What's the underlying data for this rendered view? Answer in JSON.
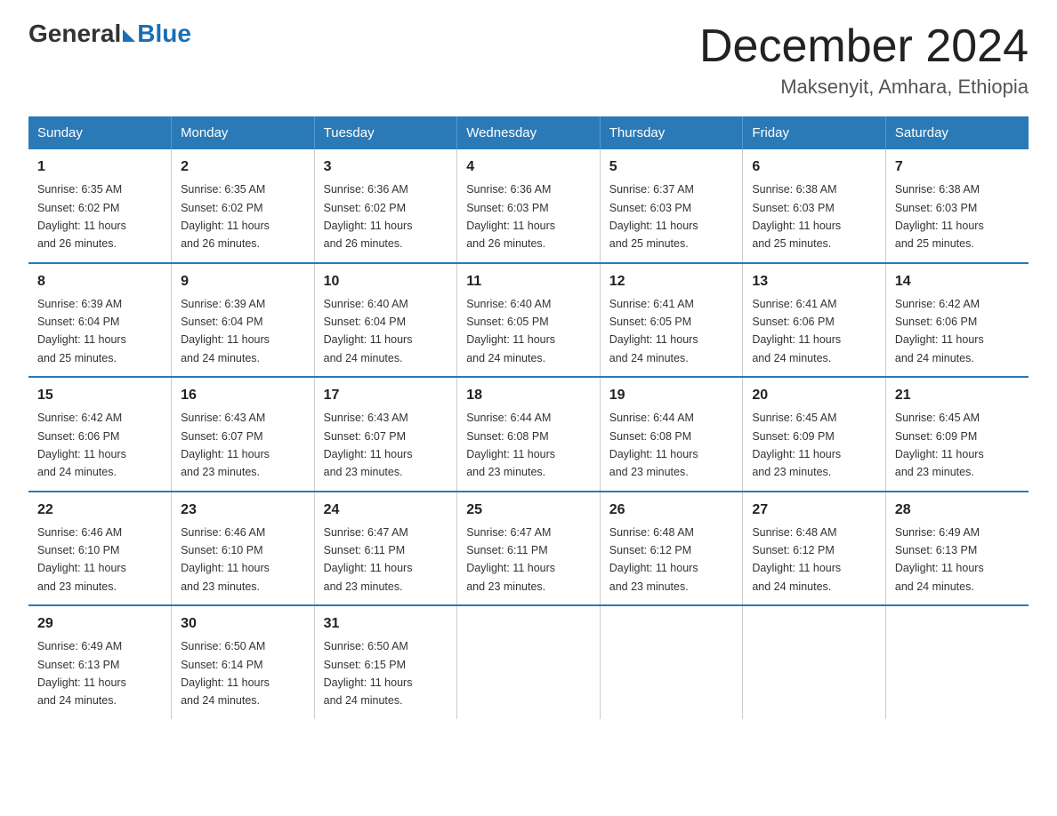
{
  "header": {
    "logo_general": "General",
    "logo_blue": "Blue",
    "title": "December 2024",
    "subtitle": "Maksenyit, Amhara, Ethiopia"
  },
  "days_of_week": [
    "Sunday",
    "Monday",
    "Tuesday",
    "Wednesday",
    "Thursday",
    "Friday",
    "Saturday"
  ],
  "weeks": [
    [
      {
        "day": "1",
        "sunrise": "6:35 AM",
        "sunset": "6:02 PM",
        "daylight": "11 hours and 26 minutes."
      },
      {
        "day": "2",
        "sunrise": "6:35 AM",
        "sunset": "6:02 PM",
        "daylight": "11 hours and 26 minutes."
      },
      {
        "day": "3",
        "sunrise": "6:36 AM",
        "sunset": "6:02 PM",
        "daylight": "11 hours and 26 minutes."
      },
      {
        "day": "4",
        "sunrise": "6:36 AM",
        "sunset": "6:03 PM",
        "daylight": "11 hours and 26 minutes."
      },
      {
        "day": "5",
        "sunrise": "6:37 AM",
        "sunset": "6:03 PM",
        "daylight": "11 hours and 25 minutes."
      },
      {
        "day": "6",
        "sunrise": "6:38 AM",
        "sunset": "6:03 PM",
        "daylight": "11 hours and 25 minutes."
      },
      {
        "day": "7",
        "sunrise": "6:38 AM",
        "sunset": "6:03 PM",
        "daylight": "11 hours and 25 minutes."
      }
    ],
    [
      {
        "day": "8",
        "sunrise": "6:39 AM",
        "sunset": "6:04 PM",
        "daylight": "11 hours and 25 minutes."
      },
      {
        "day": "9",
        "sunrise": "6:39 AM",
        "sunset": "6:04 PM",
        "daylight": "11 hours and 24 minutes."
      },
      {
        "day": "10",
        "sunrise": "6:40 AM",
        "sunset": "6:04 PM",
        "daylight": "11 hours and 24 minutes."
      },
      {
        "day": "11",
        "sunrise": "6:40 AM",
        "sunset": "6:05 PM",
        "daylight": "11 hours and 24 minutes."
      },
      {
        "day": "12",
        "sunrise": "6:41 AM",
        "sunset": "6:05 PM",
        "daylight": "11 hours and 24 minutes."
      },
      {
        "day": "13",
        "sunrise": "6:41 AM",
        "sunset": "6:06 PM",
        "daylight": "11 hours and 24 minutes."
      },
      {
        "day": "14",
        "sunrise": "6:42 AM",
        "sunset": "6:06 PM",
        "daylight": "11 hours and 24 minutes."
      }
    ],
    [
      {
        "day": "15",
        "sunrise": "6:42 AM",
        "sunset": "6:06 PM",
        "daylight": "11 hours and 24 minutes."
      },
      {
        "day": "16",
        "sunrise": "6:43 AM",
        "sunset": "6:07 PM",
        "daylight": "11 hours and 23 minutes."
      },
      {
        "day": "17",
        "sunrise": "6:43 AM",
        "sunset": "6:07 PM",
        "daylight": "11 hours and 23 minutes."
      },
      {
        "day": "18",
        "sunrise": "6:44 AM",
        "sunset": "6:08 PM",
        "daylight": "11 hours and 23 minutes."
      },
      {
        "day": "19",
        "sunrise": "6:44 AM",
        "sunset": "6:08 PM",
        "daylight": "11 hours and 23 minutes."
      },
      {
        "day": "20",
        "sunrise": "6:45 AM",
        "sunset": "6:09 PM",
        "daylight": "11 hours and 23 minutes."
      },
      {
        "day": "21",
        "sunrise": "6:45 AM",
        "sunset": "6:09 PM",
        "daylight": "11 hours and 23 minutes."
      }
    ],
    [
      {
        "day": "22",
        "sunrise": "6:46 AM",
        "sunset": "6:10 PM",
        "daylight": "11 hours and 23 minutes."
      },
      {
        "day": "23",
        "sunrise": "6:46 AM",
        "sunset": "6:10 PM",
        "daylight": "11 hours and 23 minutes."
      },
      {
        "day": "24",
        "sunrise": "6:47 AM",
        "sunset": "6:11 PM",
        "daylight": "11 hours and 23 minutes."
      },
      {
        "day": "25",
        "sunrise": "6:47 AM",
        "sunset": "6:11 PM",
        "daylight": "11 hours and 23 minutes."
      },
      {
        "day": "26",
        "sunrise": "6:48 AM",
        "sunset": "6:12 PM",
        "daylight": "11 hours and 23 minutes."
      },
      {
        "day": "27",
        "sunrise": "6:48 AM",
        "sunset": "6:12 PM",
        "daylight": "11 hours and 24 minutes."
      },
      {
        "day": "28",
        "sunrise": "6:49 AM",
        "sunset": "6:13 PM",
        "daylight": "11 hours and 24 minutes."
      }
    ],
    [
      {
        "day": "29",
        "sunrise": "6:49 AM",
        "sunset": "6:13 PM",
        "daylight": "11 hours and 24 minutes."
      },
      {
        "day": "30",
        "sunrise": "6:50 AM",
        "sunset": "6:14 PM",
        "daylight": "11 hours and 24 minutes."
      },
      {
        "day": "31",
        "sunrise": "6:50 AM",
        "sunset": "6:15 PM",
        "daylight": "11 hours and 24 minutes."
      },
      null,
      null,
      null,
      null
    ]
  ],
  "labels": {
    "sunrise": "Sunrise:",
    "sunset": "Sunset:",
    "daylight": "Daylight:"
  }
}
